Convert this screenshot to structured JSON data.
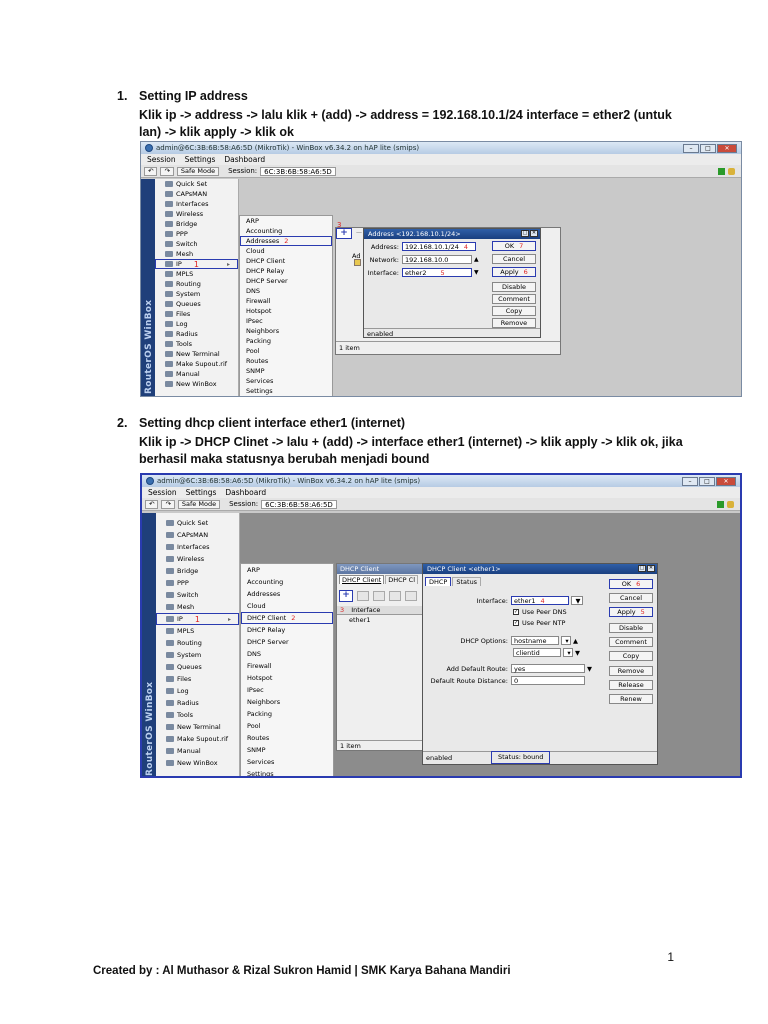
{
  "step1": {
    "num": "1.",
    "title": "Setting IP address",
    "body": "Klik ip -> address -> lalu klik + (add) -> address = 192.168.10.1/24 interface = ether2 (untuk lan) -> klik apply -> klik ok"
  },
  "step2": {
    "num": "2.",
    "title": "Setting dhcp client interface ether1 (internet)",
    "body": "Klik ip -> DHCP Clinet -> lalu + (add) -> interface ether1 (internet) -> klik apply -> klik ok, jika berhasil maka statusnya berubah menjadi bound"
  },
  "win1": {
    "title": "admin@6C:3B:6B:58:A6:5D (MikroTik) - WinBox v6.34.2 on hAP lite (smips)",
    "menu": [
      "Session",
      "Settings",
      "Dashboard"
    ],
    "safe_mode": "Safe Mode",
    "session_label": "Session:",
    "session_value": "6C:3B:6B:58:A6:5D",
    "ip_number": "1",
    "addresses_number": "2",
    "add_number": "3",
    "dlg_title": "Address <192.168.10.1/24>",
    "address_label": "Address:",
    "address_value": "192.168.10.1/24",
    "address_number": "4",
    "network_label": "Network:",
    "network_value": "192.168.10.0",
    "interface_label": "Interface:",
    "interface_value": "ether2",
    "interface_number": "5",
    "ok": "OK",
    "ok_number": "7",
    "cancel": "Cancel",
    "apply": "Apply",
    "apply_number": "6",
    "disable": "Disable",
    "comment": "Comment",
    "copy": "Copy",
    "remove": "Remove",
    "status": "enabled",
    "items": "1 item",
    "list_col": "Ad"
  },
  "win2": {
    "title": "admin@6C:3B:6B:58:A6:5D (MikroTik) - WinBox v6.34.2 on hAP lite (smips)",
    "menu": [
      "Session",
      "Settings",
      "Dashboard"
    ],
    "safe_mode": "Safe Mode",
    "session_label": "Session:",
    "session_value": "6C:3B:6B:58:A6:5D",
    "ip_number": "1",
    "dhcp_client_number": "2",
    "add_number": "3",
    "list_title": "DHCP Client",
    "tab1": "DHCP Client",
    "tab2": "DHCP Cl",
    "col_interface": "Interface",
    "col_u": "U",
    "row1": "ether1",
    "row1_flag": "y",
    "items": "1 item",
    "dlg_title": "DHCP Client <ether1>",
    "dtab1": "DHCP",
    "dtab2": "Status",
    "interface_label": "Interface:",
    "interface_value": "ether1",
    "interface_number": "4",
    "peer_dns": "Use Peer DNS",
    "peer_ntp": "Use Peer NTP",
    "options_label": "DHCP Options:",
    "option1": "hostname",
    "option2": "clientid",
    "route_label": "Add Default Route:",
    "route_value": "yes",
    "distance_label": "Default Route Distance:",
    "distance_value": "0",
    "ok": "OK",
    "ok_number": "6",
    "cancel": "Cancel",
    "apply": "Apply",
    "apply_number": "5",
    "disable": "Disable",
    "comment": "Comment",
    "copy": "Copy",
    "remove": "Remove",
    "release": "Release",
    "renew": "Renew",
    "status_left": "enabled",
    "status_right": "Status: bound"
  },
  "sidebar": [
    "Quick Set",
    "CAPsMAN",
    "Interfaces",
    "Wireless",
    "Bridge",
    "PPP",
    "Switch",
    "Mesh",
    "IP",
    "MPLS",
    "Routing",
    "System",
    "Queues",
    "Files",
    "Log",
    "Radius",
    "Tools",
    "New Terminal",
    "Make Supout.rif",
    "Manual",
    "New WinBox"
  ],
  "submenu": [
    "ARP",
    "Accounting",
    "Addresses",
    "Cloud",
    "DHCP Client",
    "DHCP Relay",
    "DHCP Server",
    "DNS",
    "Firewall",
    "Hotspot",
    "IPsec",
    "Neighbors",
    "Packing",
    "Pool",
    "Routes",
    "SNMP",
    "Services",
    "Settings"
  ],
  "vertical_label": "RouterOS WinBox",
  "page_number": "1",
  "footer": "Created by : Al Muthasor & Rizal Sukron Hamid | SMK Karya Bahana Mandiri",
  "colors": {
    "highlight_box": "#2a3bb0",
    "step_number": "#dd2222",
    "workspace": "#8c8c8c",
    "winbox_strip": "#1f3f7a"
  }
}
